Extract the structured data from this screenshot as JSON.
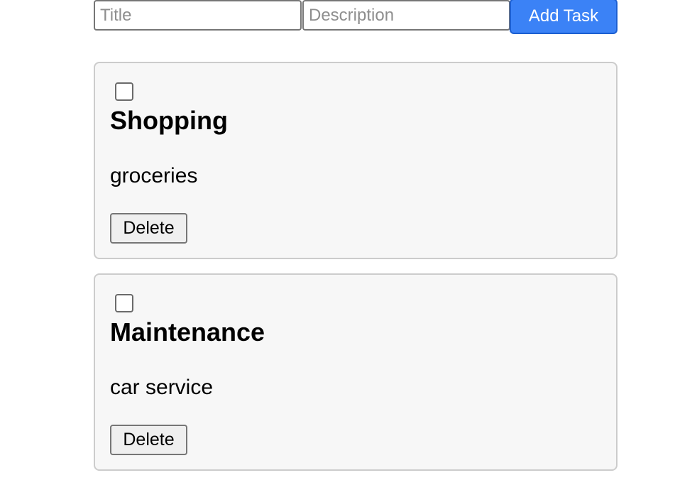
{
  "form": {
    "title_placeholder": "Title",
    "title_value": "",
    "description_placeholder": "Description",
    "description_value": "",
    "add_button_label": "Add Task"
  },
  "tasks": [
    {
      "title": "Shopping",
      "description": "groceries",
      "completed": false,
      "delete_label": "Delete"
    },
    {
      "title": "Maintenance",
      "description": "car service",
      "completed": false,
      "delete_label": "Delete"
    }
  ],
  "colors": {
    "accent": "#3b82f6",
    "card_background": "#f7f7f7",
    "card_border": "#cccccc"
  }
}
